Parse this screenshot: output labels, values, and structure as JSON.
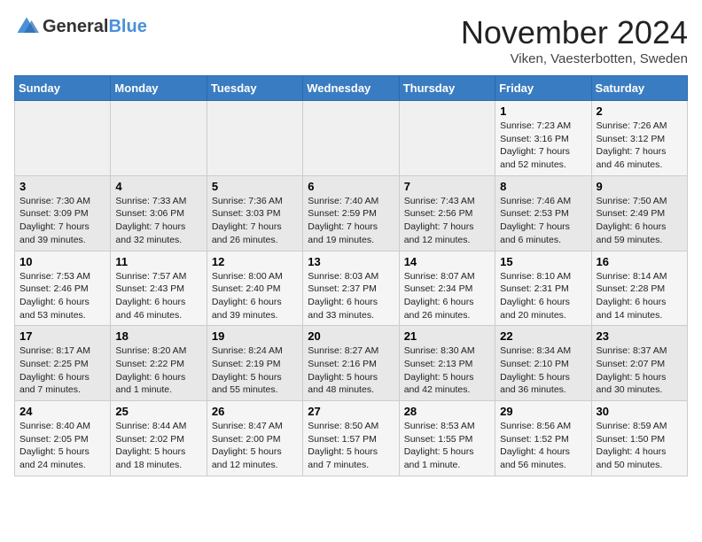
{
  "logo": {
    "general": "General",
    "blue": "Blue"
  },
  "header": {
    "month": "November 2024",
    "location": "Viken, Vaesterbotten, Sweden"
  },
  "weekdays": [
    "Sunday",
    "Monday",
    "Tuesday",
    "Wednesday",
    "Thursday",
    "Friday",
    "Saturday"
  ],
  "weeks": [
    [
      {
        "day": "",
        "info": ""
      },
      {
        "day": "",
        "info": ""
      },
      {
        "day": "",
        "info": ""
      },
      {
        "day": "",
        "info": ""
      },
      {
        "day": "",
        "info": ""
      },
      {
        "day": "1",
        "info": "Sunrise: 7:23 AM\nSunset: 3:16 PM\nDaylight: 7 hours\nand 52 minutes."
      },
      {
        "day": "2",
        "info": "Sunrise: 7:26 AM\nSunset: 3:12 PM\nDaylight: 7 hours\nand 46 minutes."
      }
    ],
    [
      {
        "day": "3",
        "info": "Sunrise: 7:30 AM\nSunset: 3:09 PM\nDaylight: 7 hours\nand 39 minutes."
      },
      {
        "day": "4",
        "info": "Sunrise: 7:33 AM\nSunset: 3:06 PM\nDaylight: 7 hours\nand 32 minutes."
      },
      {
        "day": "5",
        "info": "Sunrise: 7:36 AM\nSunset: 3:03 PM\nDaylight: 7 hours\nand 26 minutes."
      },
      {
        "day": "6",
        "info": "Sunrise: 7:40 AM\nSunset: 2:59 PM\nDaylight: 7 hours\nand 19 minutes."
      },
      {
        "day": "7",
        "info": "Sunrise: 7:43 AM\nSunset: 2:56 PM\nDaylight: 7 hours\nand 12 minutes."
      },
      {
        "day": "8",
        "info": "Sunrise: 7:46 AM\nSunset: 2:53 PM\nDaylight: 7 hours\nand 6 minutes."
      },
      {
        "day": "9",
        "info": "Sunrise: 7:50 AM\nSunset: 2:49 PM\nDaylight: 6 hours\nand 59 minutes."
      }
    ],
    [
      {
        "day": "10",
        "info": "Sunrise: 7:53 AM\nSunset: 2:46 PM\nDaylight: 6 hours\nand 53 minutes."
      },
      {
        "day": "11",
        "info": "Sunrise: 7:57 AM\nSunset: 2:43 PM\nDaylight: 6 hours\nand 46 minutes."
      },
      {
        "day": "12",
        "info": "Sunrise: 8:00 AM\nSunset: 2:40 PM\nDaylight: 6 hours\nand 39 minutes."
      },
      {
        "day": "13",
        "info": "Sunrise: 8:03 AM\nSunset: 2:37 PM\nDaylight: 6 hours\nand 33 minutes."
      },
      {
        "day": "14",
        "info": "Sunrise: 8:07 AM\nSunset: 2:34 PM\nDaylight: 6 hours\nand 26 minutes."
      },
      {
        "day": "15",
        "info": "Sunrise: 8:10 AM\nSunset: 2:31 PM\nDaylight: 6 hours\nand 20 minutes."
      },
      {
        "day": "16",
        "info": "Sunrise: 8:14 AM\nSunset: 2:28 PM\nDaylight: 6 hours\nand 14 minutes."
      }
    ],
    [
      {
        "day": "17",
        "info": "Sunrise: 8:17 AM\nSunset: 2:25 PM\nDaylight: 6 hours\nand 7 minutes."
      },
      {
        "day": "18",
        "info": "Sunrise: 8:20 AM\nSunset: 2:22 PM\nDaylight: 6 hours\nand 1 minute."
      },
      {
        "day": "19",
        "info": "Sunrise: 8:24 AM\nSunset: 2:19 PM\nDaylight: 5 hours\nand 55 minutes."
      },
      {
        "day": "20",
        "info": "Sunrise: 8:27 AM\nSunset: 2:16 PM\nDaylight: 5 hours\nand 48 minutes."
      },
      {
        "day": "21",
        "info": "Sunrise: 8:30 AM\nSunset: 2:13 PM\nDaylight: 5 hours\nand 42 minutes."
      },
      {
        "day": "22",
        "info": "Sunrise: 8:34 AM\nSunset: 2:10 PM\nDaylight: 5 hours\nand 36 minutes."
      },
      {
        "day": "23",
        "info": "Sunrise: 8:37 AM\nSunset: 2:07 PM\nDaylight: 5 hours\nand 30 minutes."
      }
    ],
    [
      {
        "day": "24",
        "info": "Sunrise: 8:40 AM\nSunset: 2:05 PM\nDaylight: 5 hours\nand 24 minutes."
      },
      {
        "day": "25",
        "info": "Sunrise: 8:44 AM\nSunset: 2:02 PM\nDaylight: 5 hours\nand 18 minutes."
      },
      {
        "day": "26",
        "info": "Sunrise: 8:47 AM\nSunset: 2:00 PM\nDaylight: 5 hours\nand 12 minutes."
      },
      {
        "day": "27",
        "info": "Sunrise: 8:50 AM\nSunset: 1:57 PM\nDaylight: 5 hours\nand 7 minutes."
      },
      {
        "day": "28",
        "info": "Sunrise: 8:53 AM\nSunset: 1:55 PM\nDaylight: 5 hours\nand 1 minute."
      },
      {
        "day": "29",
        "info": "Sunrise: 8:56 AM\nSunset: 1:52 PM\nDaylight: 4 hours\nand 56 minutes."
      },
      {
        "day": "30",
        "info": "Sunrise: 8:59 AM\nSunset: 1:50 PM\nDaylight: 4 hours\nand 50 minutes."
      }
    ]
  ]
}
